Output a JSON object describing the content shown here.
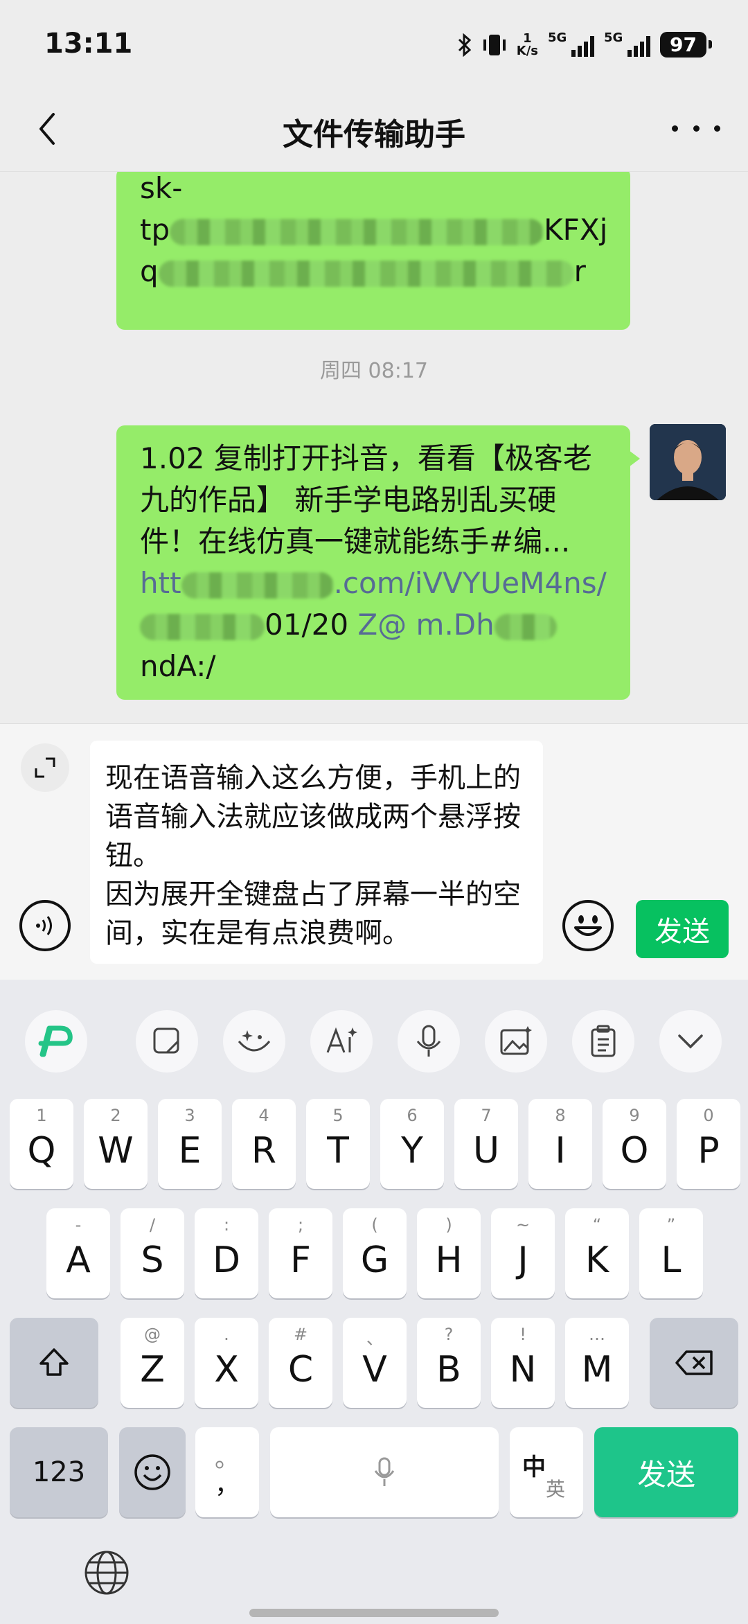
{
  "status": {
    "time": "13:11",
    "net_speed_value": "1",
    "net_speed_unit": "K/s",
    "signal1": "5G",
    "signal2": "5G",
    "battery": "97"
  },
  "nav": {
    "title": "文件传输助手",
    "back_icon": "chevron-left-icon",
    "more_icon": "more-dots-icon"
  },
  "chat": {
    "msg1_lines": [
      "sk-",
      "tp",
      "q"
    ],
    "msg1_tail2": "KFXj",
    "msg1_tail3": "r",
    "timestamp": "周四 08:17",
    "msg2_text": "1.02 复制打开抖音，看看【极客老九的作品】 新手学电路别乱买硬件！在线仿真一键就能练手#编...",
    "msg2_link1": "htt",
    "msg2_link1_end": ".com/",
    "msg2_link2": "iVVYUeM4ns/",
    "msg2_after_link": "01/20",
    "msg2_tail1": "Z@",
    "msg2_tail2": "m.Dh",
    "msg2_tail3": "ndA:/"
  },
  "input": {
    "text": "现在语音输入这么方便，手机上的语音输入法就应该做成两个悬浮按钮。\n因为展开全键盘占了屏幕一半的空间，实在是有点浪费啊。",
    "send_label": "发送"
  },
  "keyboard": {
    "toolbar_icons": [
      "keyboard-logo-icon",
      "clipboard-edit-icon",
      "emoji-sparkle-icon",
      "ai-icon",
      "microphone-icon",
      "image-icon",
      "clipboard-icon",
      "chevron-down-icon"
    ],
    "row1": [
      {
        "hint": "1",
        "key": "Q"
      },
      {
        "hint": "2",
        "key": "W"
      },
      {
        "hint": "3",
        "key": "E"
      },
      {
        "hint": "4",
        "key": "R"
      },
      {
        "hint": "5",
        "key": "T"
      },
      {
        "hint": "6",
        "key": "Y"
      },
      {
        "hint": "7",
        "key": "U"
      },
      {
        "hint": "8",
        "key": "I"
      },
      {
        "hint": "9",
        "key": "O"
      },
      {
        "hint": "0",
        "key": "P"
      }
    ],
    "row2": [
      {
        "hint": "-",
        "key": "A"
      },
      {
        "hint": "/",
        "key": "S"
      },
      {
        "hint": ":",
        "key": "D"
      },
      {
        "hint": ";",
        "key": "F"
      },
      {
        "hint": "(",
        "key": "G"
      },
      {
        "hint": ")",
        "key": "H"
      },
      {
        "hint": "~",
        "key": "J"
      },
      {
        "hint": "“",
        "key": "K"
      },
      {
        "hint": "”",
        "key": "L"
      }
    ],
    "row3": [
      {
        "hint": "@",
        "key": "Z"
      },
      {
        "hint": ".",
        "key": "X"
      },
      {
        "hint": "#",
        "key": "C"
      },
      {
        "hint": "、",
        "key": "V"
      },
      {
        "hint": "?",
        "key": "B"
      },
      {
        "hint": "!",
        "key": "N"
      },
      {
        "hint": "…",
        "key": "M"
      }
    ],
    "numbers_label": "123",
    "punct_top": "。",
    "punct_bottom": "，",
    "lang_main": "中",
    "lang_sub": "英",
    "send_label": "发送"
  }
}
